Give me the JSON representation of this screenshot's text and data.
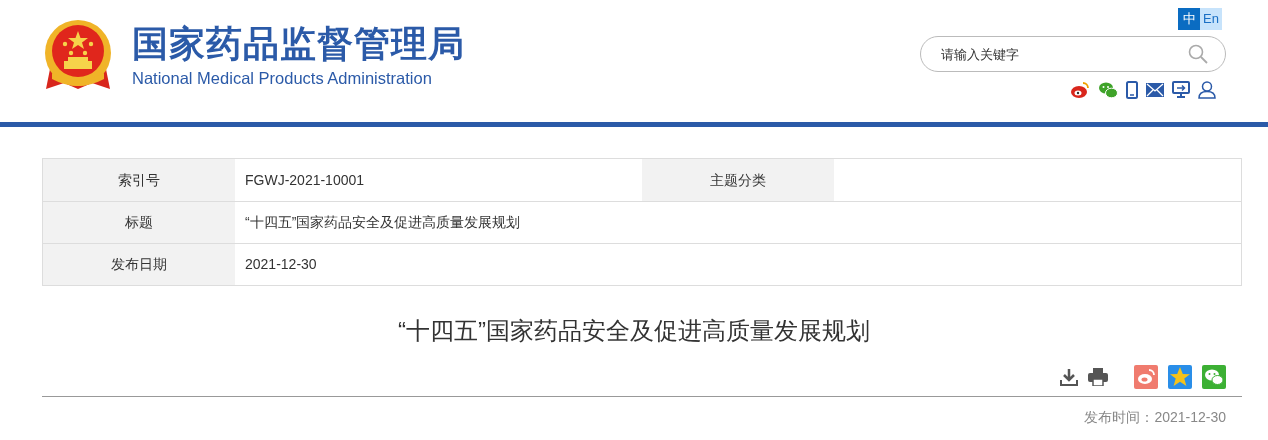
{
  "header": {
    "title": "国家药品监督管理局",
    "subtitle": "National Medical Products Administration",
    "languages": [
      {
        "label": "中",
        "selected": true
      },
      {
        "label": "En",
        "selected": false
      }
    ],
    "search": {
      "placeholder": "请输入关键字"
    }
  },
  "info_table": {
    "rows": [
      {
        "fields": [
          {
            "label": "索引号",
            "value": "FGWJ-2021-10001"
          },
          {
            "label": "主题分类"
          }
        ]
      },
      {
        "fields": [
          {
            "label": "标题",
            "value": "“十四五”国家药品安全及促进高质量发展规划"
          }
        ]
      },
      {
        "fields": [
          {
            "label": "发布日期",
            "value": "2021-12-30"
          }
        ]
      }
    ]
  },
  "article": {
    "title": "“十四五”国家药品安全及促进高质量发展规划",
    "publish_time": "发布时间：2021-12-30"
  }
}
